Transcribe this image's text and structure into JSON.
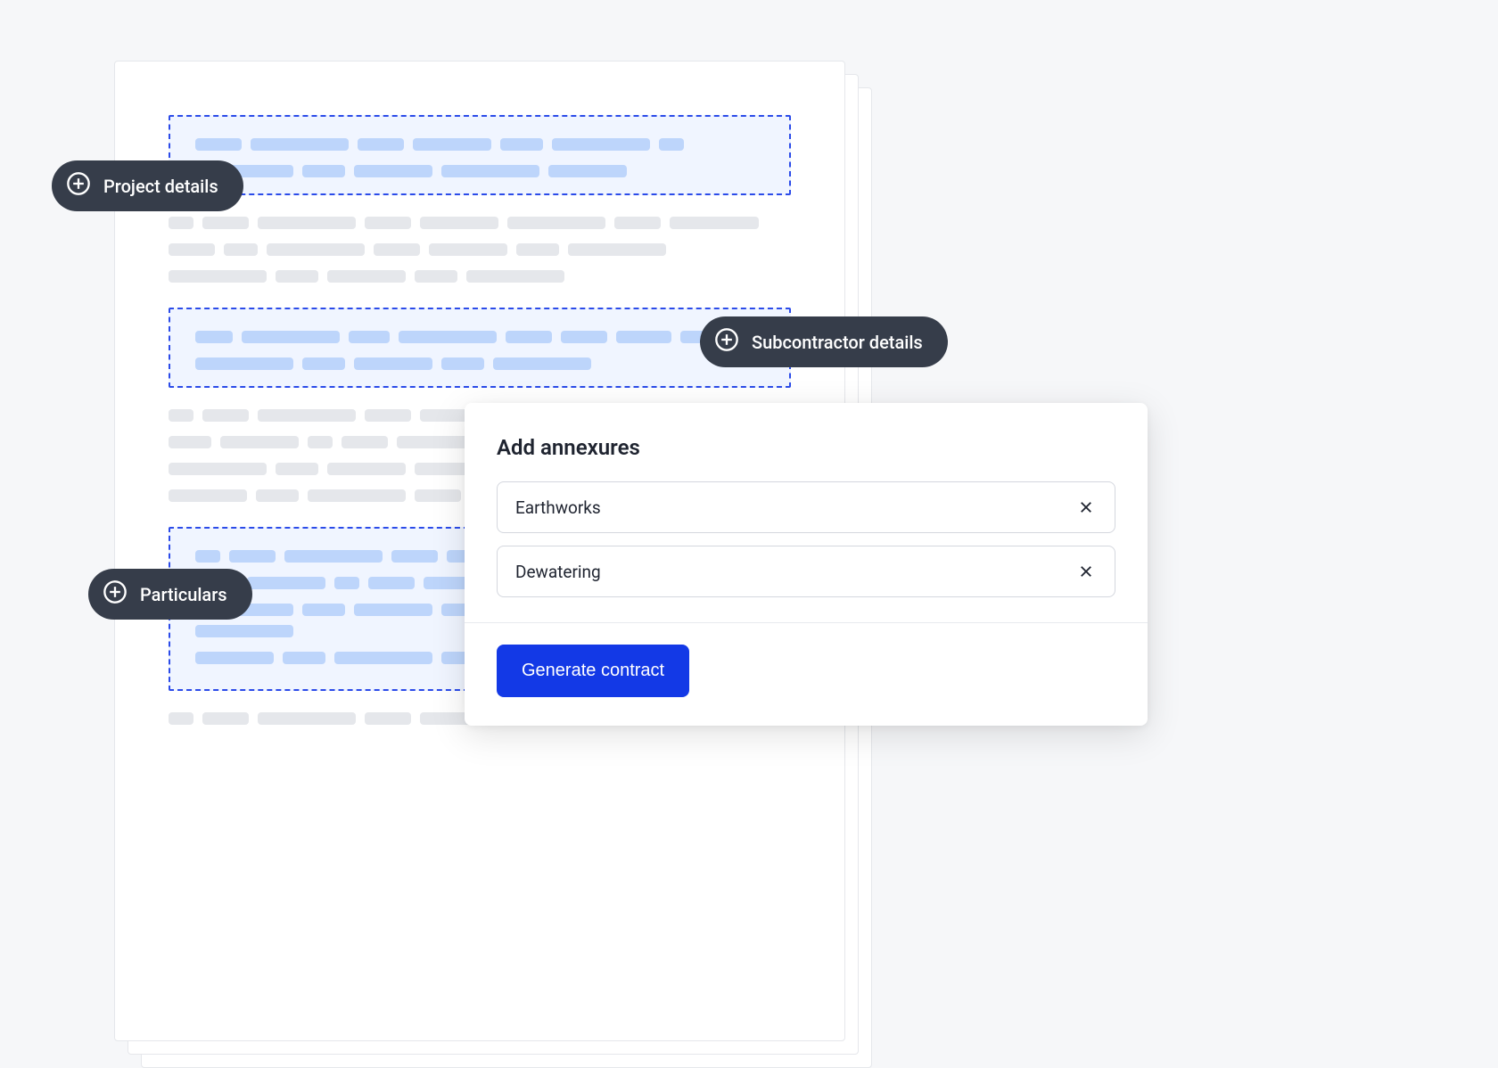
{
  "pills": {
    "project_details": "Project details",
    "subcontractor_details": "Subcontractor details",
    "particulars": "Particulars"
  },
  "annexures": {
    "title": "Add annexures",
    "items": [
      {
        "label": "Earthworks"
      },
      {
        "label": "Dewatering"
      }
    ],
    "generate_label": "Generate contract"
  },
  "colors": {
    "pill_bg": "#363d4a",
    "accent_blue": "#1339e6",
    "dashed_border": "#2b4be9",
    "editable_bg": "#f0f5ff",
    "editable_bar": "#bdd5fb",
    "plain_bar": "#e5e7eb"
  }
}
